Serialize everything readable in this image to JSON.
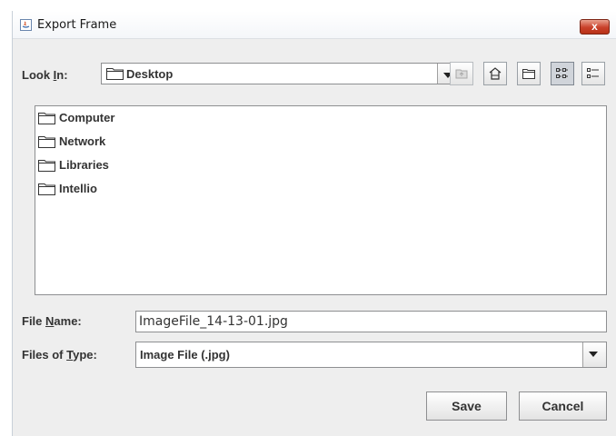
{
  "window": {
    "title": "Export Frame",
    "close_label": "x"
  },
  "look_in": {
    "label_pre": "Look ",
    "label_u": "I",
    "label_post": "n:",
    "selected": "Desktop"
  },
  "toolbar": {
    "icons": [
      "up-one-level-icon",
      "home-icon",
      "new-folder-icon",
      "list-view-icon",
      "details-view-icon"
    ]
  },
  "files": {
    "items": [
      {
        "name": "Computer",
        "icon": "folder-icon"
      },
      {
        "name": "Network",
        "icon": "folder-icon"
      },
      {
        "name": "Libraries",
        "icon": "folder-icon"
      },
      {
        "name": "Intellio",
        "icon": "folder-icon"
      }
    ]
  },
  "file_name": {
    "label_pre": "File ",
    "label_u": "N",
    "label_post": "ame:",
    "value": "ImageFile_14-13-01.jpg"
  },
  "file_type": {
    "label_pre": "Files of ",
    "label_u": "T",
    "label_post": "ype:",
    "selected": "Image File (.jpg)"
  },
  "buttons": {
    "save": "Save",
    "cancel": "Cancel"
  }
}
